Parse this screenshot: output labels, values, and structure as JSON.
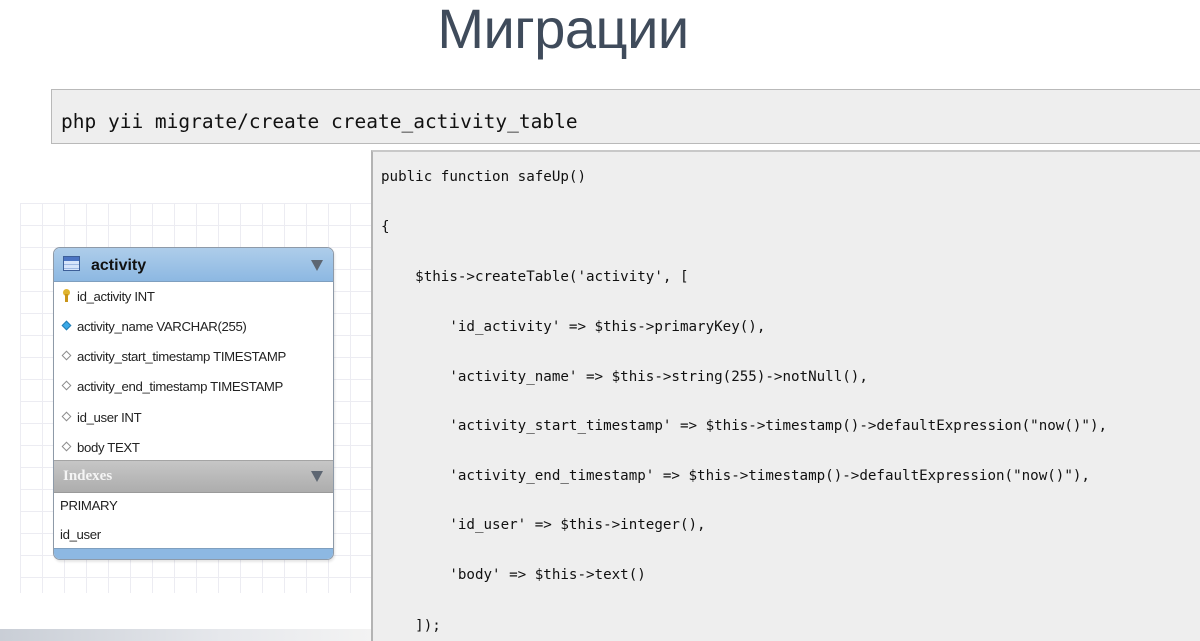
{
  "slide": {
    "title": "Миграции"
  },
  "command": {
    "text": "php yii migrate/create create_activity_table"
  },
  "code": {
    "lines": [
      "public function safeUp()",
      "{",
      "    $this->createTable('activity', [",
      "        'id_activity' => $this->primaryKey(),",
      "        'activity_name' => $this->string(255)->notNull(),",
      "        'activity_start_timestamp' => $this->timestamp()->defaultExpression(\"now()\"),",
      "        'activity_end_timestamp' => $this->timestamp()->defaultExpression(\"now()\"),",
      "        'id_user' => $this->integer(),",
      "        'body' => $this->text()",
      "    ]);"
    ]
  },
  "entity": {
    "name": "activity",
    "icon": "table-icon",
    "fields": [
      {
        "label": "id_activity INT",
        "icon": "key-icon"
      },
      {
        "label": "activity_name VARCHAR(255)",
        "icon": "diamond-filled-icon"
      },
      {
        "label": "activity_start_timestamp TIMESTAMP",
        "icon": "diamond-icon"
      },
      {
        "label": "activity_end_timestamp TIMESTAMP",
        "icon": "diamond-icon"
      },
      {
        "label": "id_user INT",
        "icon": "diamond-icon"
      },
      {
        "label": "body TEXT",
        "icon": "diamond-icon"
      }
    ],
    "indexes_title": "Indexes",
    "indexes": [
      "PRIMARY",
      "id_user"
    ]
  },
  "colors": {
    "title": "#3f4b5b",
    "entity_header": "#8db8e2",
    "indexes_header": "#adadad",
    "code_background": "#eeeeee"
  }
}
